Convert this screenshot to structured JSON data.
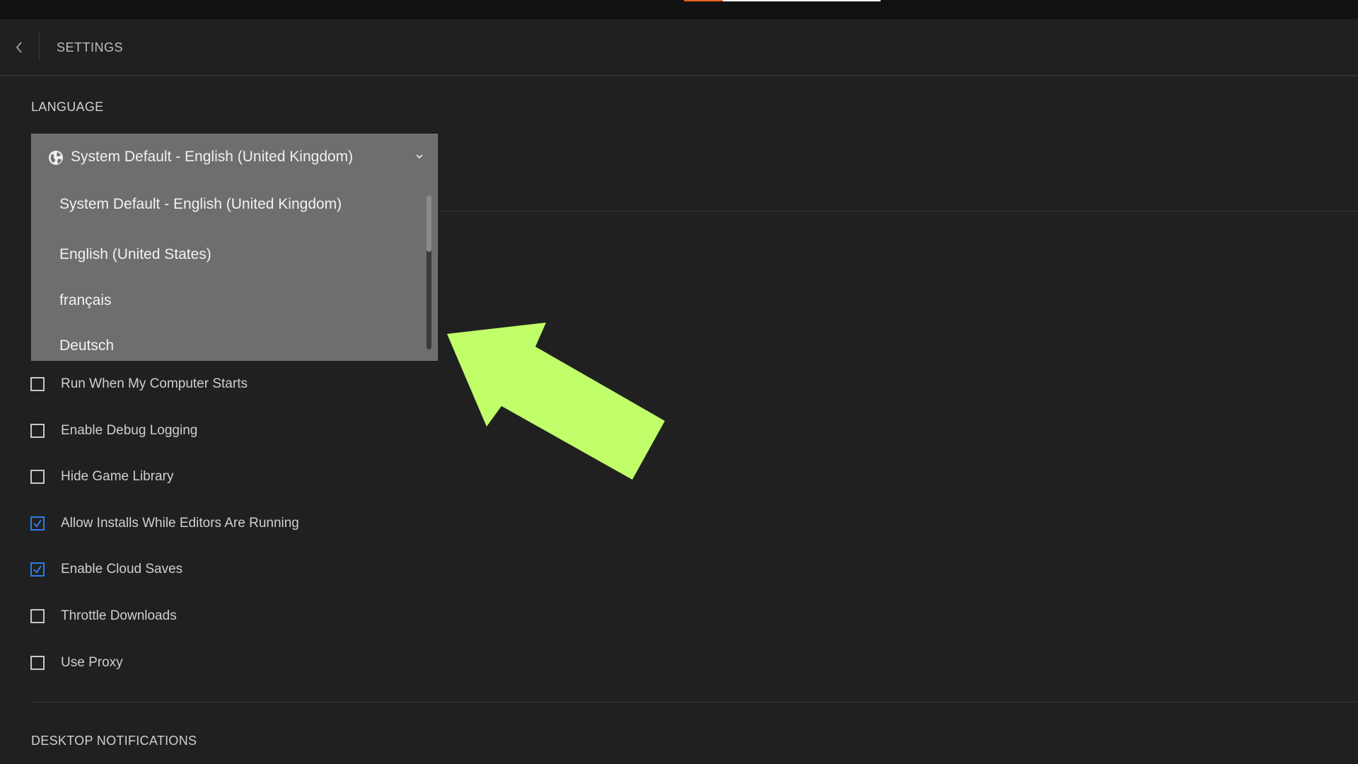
{
  "header": {
    "title": "SETTINGS"
  },
  "language": {
    "section_title": "LANGUAGE",
    "selected": "System Default - English (United Kingdom)",
    "options": [
      "System Default - English (United Kingdom)",
      "English (United States)",
      "français",
      "Deutsch"
    ]
  },
  "options": [
    {
      "label": "Run When My Computer Starts",
      "checked": false
    },
    {
      "label": "Enable Debug Logging",
      "checked": false
    },
    {
      "label": "Hide Game Library",
      "checked": false
    },
    {
      "label": "Allow Installs While Editors Are Running",
      "checked": true
    },
    {
      "label": "Enable Cloud Saves",
      "checked": true
    },
    {
      "label": "Throttle Downloads",
      "checked": false
    },
    {
      "label": "Use Proxy",
      "checked": false
    }
  ],
  "notifications": {
    "section_title": "DESKTOP NOTIFICATIONS"
  },
  "icons": {
    "back": "chevron-left-icon",
    "language": "globe-icon",
    "dropdown": "chevron-down-icon",
    "checkmark": "checkmark-icon",
    "annotation": "arrow-annotation"
  },
  "colors": {
    "background": "#202020",
    "topbar": "#121212",
    "dropdown": "#6d6e6d",
    "checked": "#2b7de9",
    "accent_strip": "#e8621f",
    "annotation_arrow": "#c0ff6a"
  }
}
